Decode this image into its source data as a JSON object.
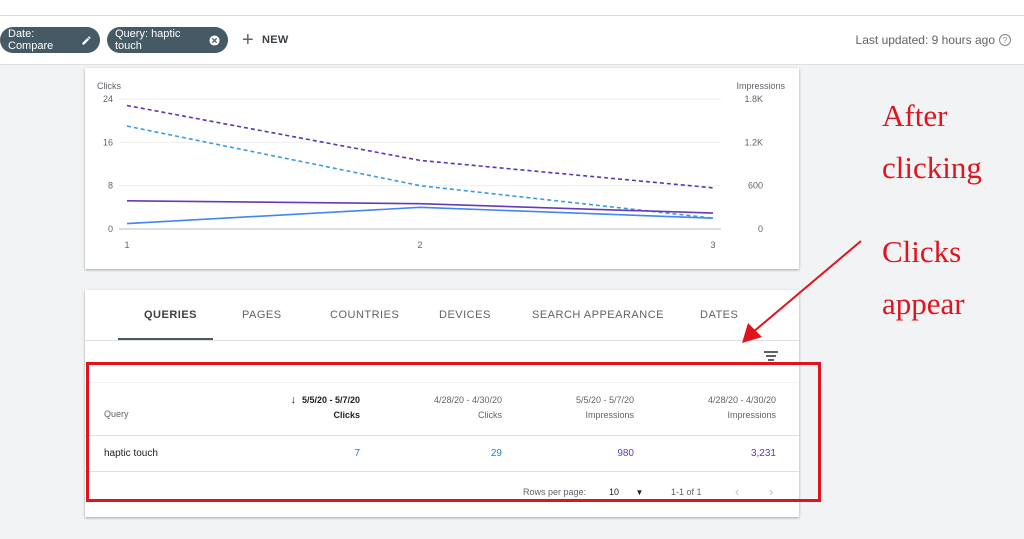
{
  "filters": {
    "chips": [
      {
        "label": "Date: Compare",
        "icon": "pencil-icon"
      },
      {
        "label": "Query: haptic touch",
        "icon": "close-circle-icon"
      }
    ],
    "new_label": "NEW",
    "last_updated": "Last updated: 9 hours ago"
  },
  "colors": {
    "chip_bg": "#455a64",
    "clicks_current": "#4285f4",
    "clicks_previous": "#3b9be0",
    "impressions_current": "#673ab7",
    "impressions_previous": "#5e35b1",
    "annotation_red": "#e0141e"
  },
  "chart_data": {
    "type": "line",
    "x": [
      1,
      2,
      3
    ],
    "left_axis": {
      "label": "Clicks",
      "ticks": [
        "24",
        "16",
        "8",
        "0"
      ],
      "range": [
        0,
        24
      ]
    },
    "right_axis": {
      "label": "Impressions",
      "ticks": [
        "1.8K",
        "1.2K",
        "600",
        "0"
      ],
      "range": [
        0,
        1800
      ]
    },
    "x_ticks": [
      "1",
      "2",
      "3"
    ],
    "grid": true,
    "series": [
      {
        "axis": "left",
        "style": "solid",
        "color": "#4285f4",
        "values": [
          1,
          4,
          2
        ]
      },
      {
        "axis": "left",
        "style": "dashed",
        "color": "#3b9be0",
        "values": [
          19,
          8,
          2
        ]
      },
      {
        "axis": "right",
        "style": "solid",
        "color": "#673ab7",
        "values": [
          390,
          350,
          220
        ]
      },
      {
        "axis": "right",
        "style": "dashed",
        "color": "#5e35b1",
        "values": [
          1710,
          950,
          570
        ]
      }
    ]
  },
  "tabs": [
    "QUERIES",
    "PAGES",
    "COUNTRIES",
    "DEVICES",
    "SEARCH APPEARANCE",
    "DATES"
  ],
  "table": {
    "query_header": "Query",
    "columns": [
      {
        "dates": "5/5/20 - 5/7/20",
        "metric": "Clicks",
        "sorted": true
      },
      {
        "dates": "4/28/20 - 4/30/20",
        "metric": "Clicks",
        "sorted": false
      },
      {
        "dates": "5/5/20 - 5/7/20",
        "metric": "Impressions",
        "sorted": false
      },
      {
        "dates": "4/28/20 - 4/30/20",
        "metric": "Impressions",
        "sorted": false
      }
    ],
    "rows": [
      {
        "query": "haptic touch",
        "values": [
          "7",
          "29",
          "980",
          "3,231"
        ]
      }
    ],
    "pagination": {
      "rows_per_page_label": "Rows per page:",
      "rows_per_page": "10",
      "range": "1-1 of 1"
    }
  },
  "annotations": {
    "line1": "After",
    "line2": "clicking",
    "line3": "Clicks",
    "line4": "appear"
  }
}
